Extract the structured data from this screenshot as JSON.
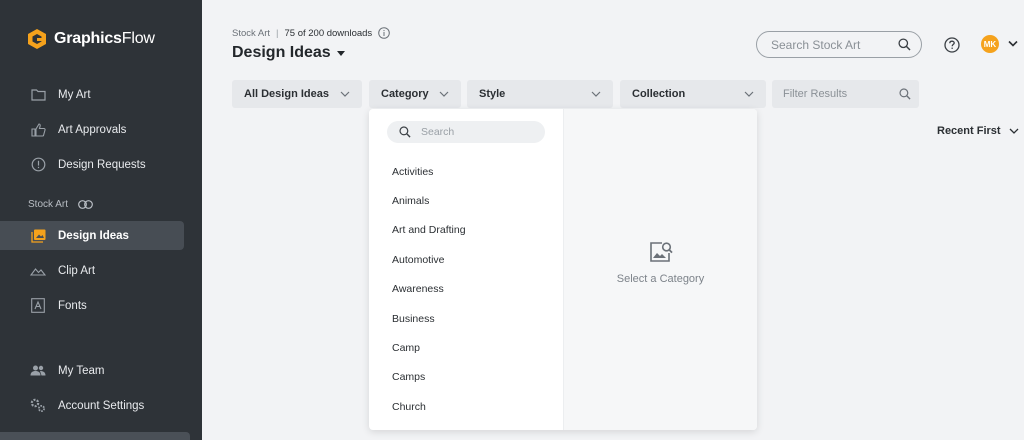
{
  "brand": {
    "name_bold": "Graphics",
    "name_light": "Flow",
    "accent": "#f5a21c"
  },
  "sidebar": {
    "items_top": [
      {
        "label": "My Art",
        "icon": "folder-icon"
      },
      {
        "label": "Art Approvals",
        "icon": "thumbs-up-icon"
      },
      {
        "label": "Design Requests",
        "icon": "alert-circle-icon"
      }
    ],
    "section_label": "Stock Art",
    "items_stock": [
      {
        "label": "Design Ideas",
        "icon": "image-gallery-icon",
        "active": true
      },
      {
        "label": "Clip Art",
        "icon": "mountain-icon"
      },
      {
        "label": "Fonts",
        "icon": "font-icon"
      }
    ],
    "items_bottom": [
      {
        "label": "My Team",
        "icon": "team-icon"
      },
      {
        "label": "Account Settings",
        "icon": "settings-icon"
      }
    ]
  },
  "header": {
    "breadcrumb": "Stock Art",
    "separator": "|",
    "download_count": "75 of 200 downloads",
    "title": "Design Ideas",
    "search_placeholder": "Search Stock Art",
    "avatar_initials": "MK"
  },
  "filters": {
    "design_ideas": "All Design Ideas",
    "category": "Category",
    "style": "Style",
    "collection": "Collection",
    "results_placeholder": "Filter Results"
  },
  "sort": {
    "label": "Recent First"
  },
  "dropdown": {
    "search_placeholder": "Search",
    "categories": [
      "Activities",
      "Animals",
      "Art and Drafting",
      "Automotive",
      "Awareness",
      "Business",
      "Camp",
      "Camps",
      "Church"
    ],
    "empty_text": "Select a Category"
  }
}
